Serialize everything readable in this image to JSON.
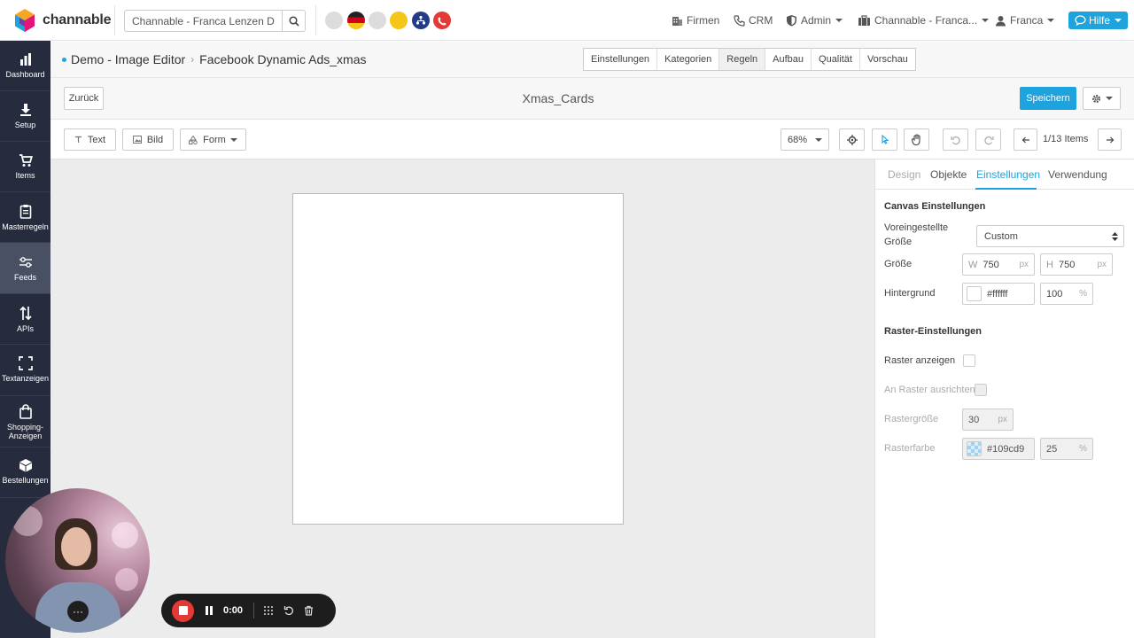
{
  "brand": {
    "name": "channable"
  },
  "search": {
    "value": "Channable - Franca Lenzen Demo"
  },
  "top_nav": {
    "firmen": "Firmen",
    "crm": "CRM",
    "admin": "Admin",
    "account": "Channable - Franca...",
    "user": "Franca",
    "hilfe": "Hilfe"
  },
  "sidebar": {
    "items": [
      {
        "label": "Dashboard",
        "icon": "bar-chart-icon"
      },
      {
        "label": "Setup",
        "icon": "download-icon"
      },
      {
        "label": "Items",
        "icon": "cart-icon"
      },
      {
        "label": "Masterregeln",
        "icon": "clipboard-icon"
      },
      {
        "label": "Feeds",
        "icon": "sliders-icon"
      },
      {
        "label": "APIs",
        "icon": "arrows-updown-icon"
      },
      {
        "label": "Textanzeigen",
        "icon": "expand-icon"
      },
      {
        "label": "Shopping-Anzeigen",
        "icon": "shopping-bag-icon"
      },
      {
        "label": "Bestellungen",
        "icon": "box-icon"
      }
    ]
  },
  "breadcrumb": {
    "project": "Demo - Image Editor",
    "feed": "Facebook Dynamic Ads_xmas"
  },
  "steps": [
    "Einstellungen",
    "Kategorien",
    "Regeln",
    "Aufbau",
    "Qualität",
    "Vorschau"
  ],
  "active_step": "Regeln",
  "header": {
    "back": "Zurück",
    "title": "Xmas_Cards",
    "save": "Speichern"
  },
  "toolbar": {
    "text": "Text",
    "bild": "Bild",
    "form": "Form",
    "zoom": "68%",
    "items_counter": "1/13 Items"
  },
  "panel": {
    "tabs": [
      "Design",
      "Objekte",
      "Einstellungen",
      "Verwendung"
    ],
    "active_tab": "Einstellungen",
    "canvas_title": "Canvas Einstellungen",
    "preset_label": "Voreingestellte Größe",
    "preset_value": "Custom",
    "size_label": "Größe",
    "width_prefix": "W",
    "width": "750",
    "height_prefix": "H",
    "height": "750",
    "unit_px": "px",
    "bg_label": "Hintergrund",
    "bg_color": "#ffffff",
    "bg_opacity": "100",
    "unit_pct": "%",
    "grid_title": "Raster-Einstellungen",
    "grid_show": "Raster anzeigen",
    "grid_snap": "An Raster ausrichten",
    "grid_size_label": "Rastergröße",
    "grid_size": "30",
    "grid_color_label": "Rasterfarbe",
    "grid_color": "#109cd9",
    "grid_opacity": "25"
  },
  "recorder": {
    "time": "0:00"
  },
  "colors": {
    "accent": "#1fa3dc",
    "sidebar": "#262b3d",
    "record": "#e53935"
  }
}
